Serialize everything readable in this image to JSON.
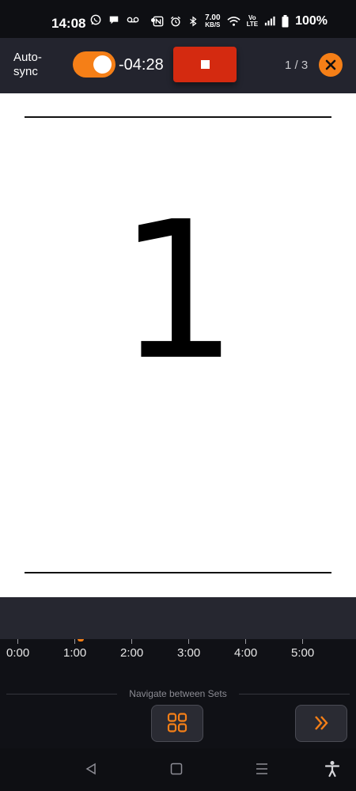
{
  "status_bar": {
    "time": "14:08",
    "speed_value": "7.00",
    "speed_unit": "KB/S",
    "volte_top": "Vo",
    "volte_bottom": "LTE",
    "battery": "100%",
    "left_icons": [
      "whatsapp-icon",
      "chat-bubble-icon",
      "voicemail-icon",
      "notification-dot"
    ],
    "right_icons": [
      "nfc-icon",
      "alarm-icon",
      "bluetooth-icon",
      "wifi-icon",
      "signal-icon",
      "battery-icon"
    ]
  },
  "top_bar": {
    "autosync_label_line1": "Auto-",
    "autosync_label_line2": "sync",
    "autosync_enabled": true,
    "countdown": "-04:28",
    "stop_icon": "stop-icon",
    "page_counter": "1 / 3",
    "close_icon": "close-icon"
  },
  "main_display": {
    "value": "1"
  },
  "timeline": {
    "labels": [
      "0:00",
      "1:00",
      "2:00",
      "3:00",
      "4:00",
      "5:00"
    ]
  },
  "navigation": {
    "caption": "Navigate between Sets",
    "grid_button_icon": "grid-icon",
    "next_button_icon": "double-chevron-right-icon"
  },
  "system_nav": {
    "icons": [
      "back-icon",
      "home-icon",
      "recents-icon",
      "accessibility-icon"
    ]
  },
  "colors": {
    "accent": "#f57f17",
    "stop_red": "#d42a10",
    "top_bar_bg": "#23242e",
    "bottom_bg": "#101116"
  }
}
